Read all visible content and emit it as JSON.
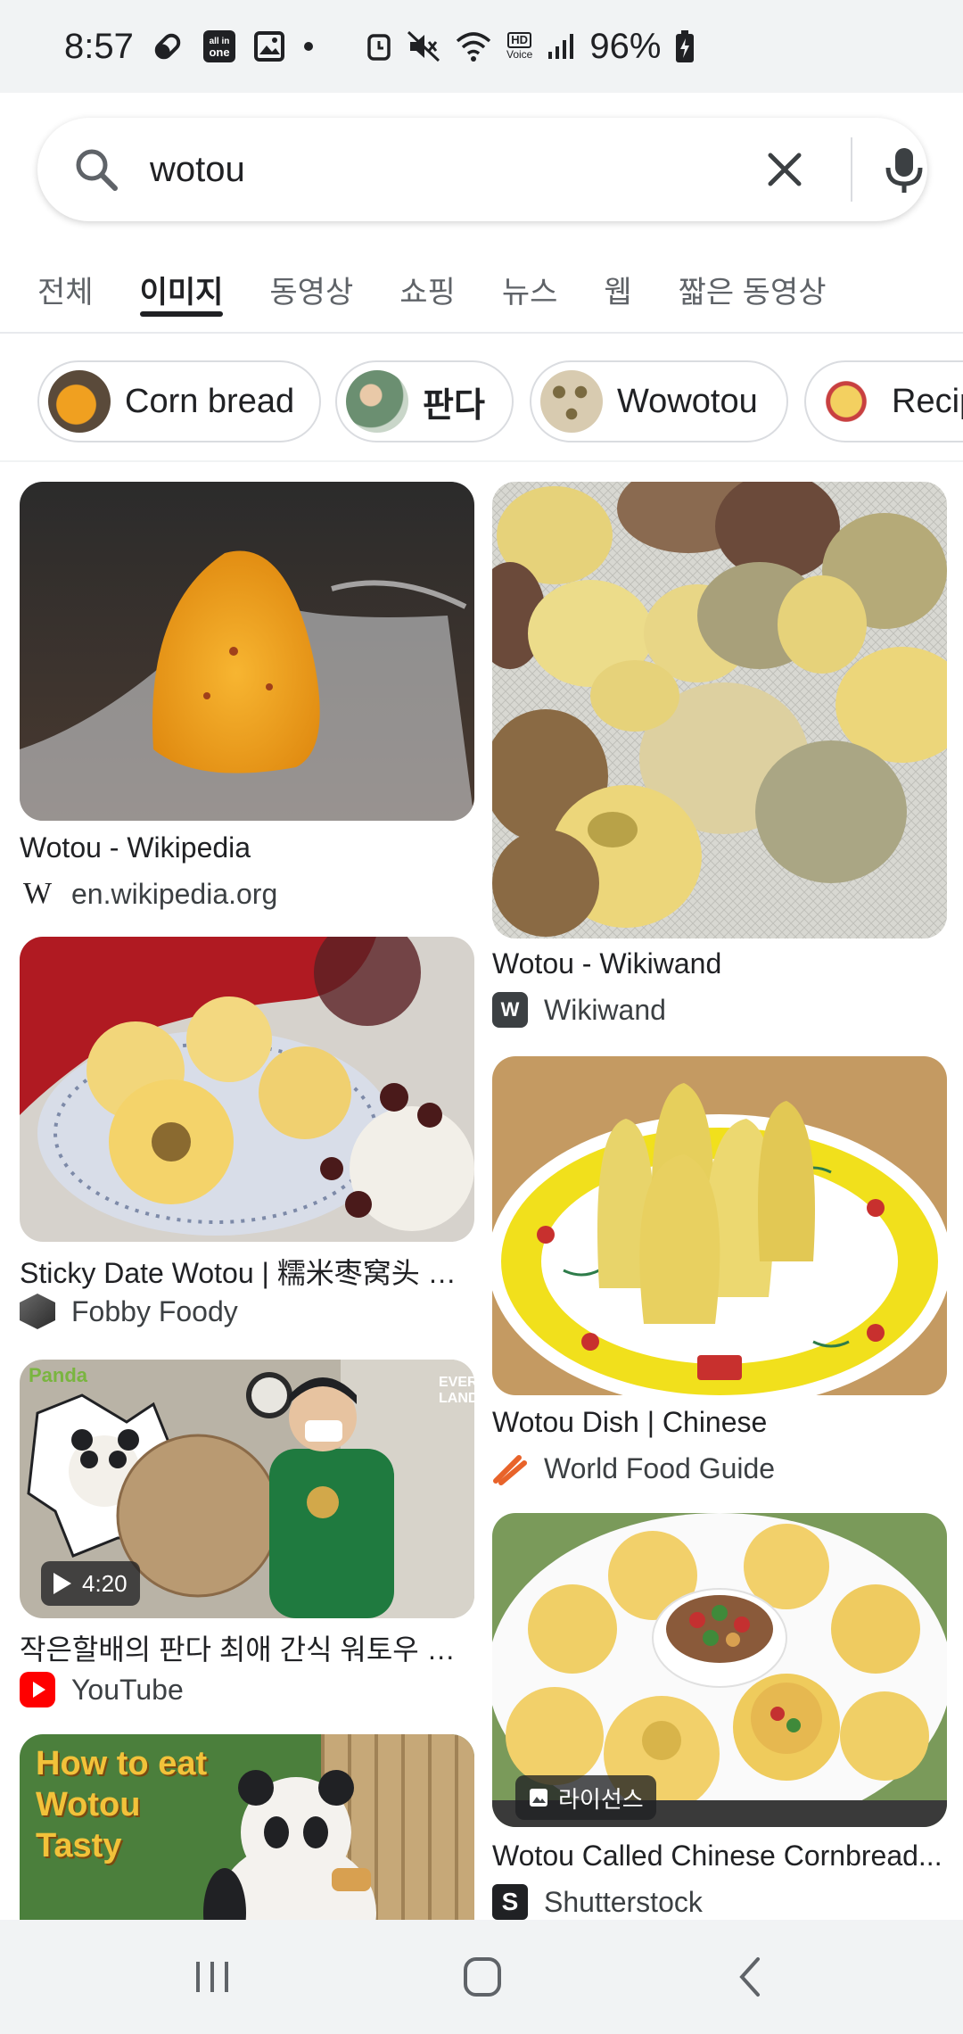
{
  "status_bar": {
    "time": "8:57",
    "battery": "96%",
    "hd_voice_line1": "HD",
    "hd_voice_line2": "Voice",
    "allinone_line1": "all in",
    "allinone_line2": "one"
  },
  "search": {
    "query": "wotou"
  },
  "tabs": [
    {
      "label": "전체",
      "active": false
    },
    {
      "label": "이미지",
      "active": true
    },
    {
      "label": "동영상",
      "active": false
    },
    {
      "label": "쇼핑",
      "active": false
    },
    {
      "label": "뉴스",
      "active": false
    },
    {
      "label": "웹",
      "active": false
    },
    {
      "label": "짧은 동영상",
      "active": false
    }
  ],
  "chips": [
    {
      "label": "Corn bread"
    },
    {
      "label": "판다"
    },
    {
      "label": "Wowotou"
    },
    {
      "label": "Recipe"
    }
  ],
  "results": {
    "left": [
      {
        "title": "Wotou - Wikipedia",
        "source": "en.wikipedia.org",
        "source_icon": "wikipedia-icon"
      },
      {
        "title": "Sticky Date Wotou | 糯米枣窝头 —...",
        "source": "Fobby Foody",
        "source_icon": "fobby-foody-icon"
      },
      {
        "title": "작은할배의 판다 최애 간식 워토우 황...",
        "source": "YouTube",
        "source_icon": "youtube-icon",
        "duration": "4:20"
      },
      {
        "title": "",
        "source": "",
        "overlay_text_line1": "How to eat",
        "overlay_text_line2": "Wotou",
        "overlay_text_line3": "Tasty"
      }
    ],
    "right": [
      {
        "title": "Wotou - Wikiwand",
        "source": "Wikiwand",
        "source_icon": "wikiwand-icon"
      },
      {
        "title": "Wotou Dish | Chinese",
        "source": "World Food Guide",
        "source_icon": "world-food-guide-icon"
      },
      {
        "title": "Wotou Called Chinese Cornbread...",
        "source": "Shutterstock",
        "source_icon": "shutterstock-icon",
        "license_label": "라이선스"
      }
    ]
  },
  "colors": {
    "status_bg": "#f1f3f4",
    "active_tab": "#202124",
    "youtube_red": "#ff0000"
  }
}
